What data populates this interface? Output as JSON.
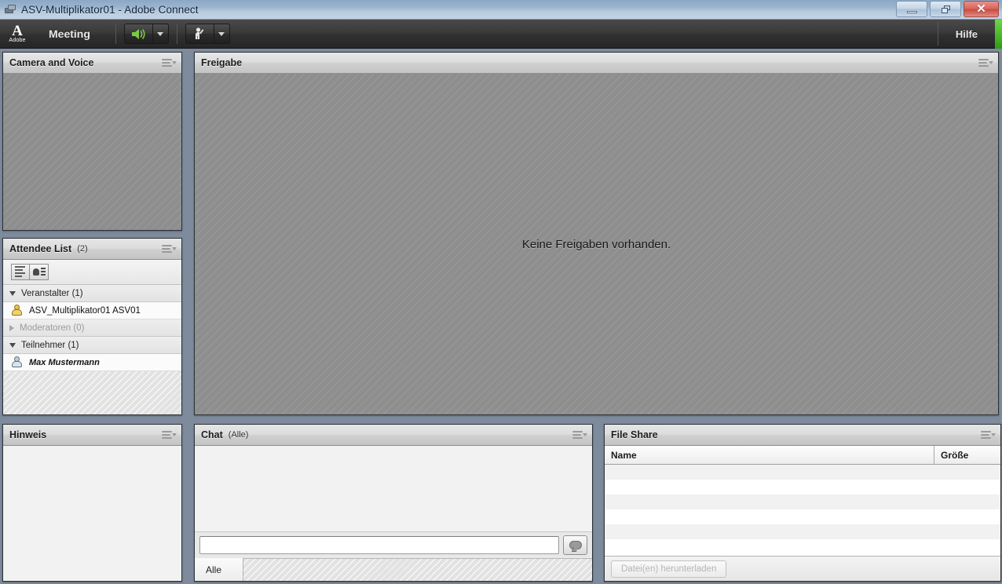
{
  "window": {
    "title": "ASV-Multiplikator01 - Adobe Connect",
    "icon": "app-icon",
    "minimize_label": "Minimieren",
    "restore_label": "Wiederherstellen",
    "close_label": "Schließen"
  },
  "toolbar": {
    "brand": "A",
    "brand_word": "Adobe",
    "meeting_label": "Meeting",
    "speaker_icon": "speaker-on-icon",
    "hand_icon": "raise-hand-icon",
    "help_label": "Hilfe",
    "accent_color": "#4fc229",
    "speaker_color": "#7ac943"
  },
  "camera_pod": {
    "title": "Camera and Voice",
    "menu_icon": "pod-options-icon"
  },
  "attendee_pod": {
    "title": "Attendee List",
    "count_label": "(2)",
    "menu_icon": "pod-options-icon",
    "view_buttons": [
      {
        "name": "list-view-button",
        "icon": "list-view-icon"
      },
      {
        "name": "card-view-button",
        "icon": "card-view-icon"
      }
    ],
    "groups": [
      {
        "label": "Veranstalter (1)",
        "expanded": true,
        "members": [
          {
            "name": "ASV_Multiplikator01 ASV01",
            "role": "host",
            "icon": "host-user-icon",
            "italic": false
          }
        ]
      },
      {
        "label": "Moderatoren (0)",
        "expanded": false,
        "dimmed": true,
        "members": []
      },
      {
        "label": "Teilnehmer (1)",
        "expanded": true,
        "members": [
          {
            "name": "Max Mustermann",
            "role": "participant",
            "icon": "participant-user-icon",
            "italic": true
          }
        ]
      }
    ]
  },
  "share_pod": {
    "title": "Freigabe",
    "menu_icon": "pod-options-icon",
    "empty_message": "Keine Freigaben vorhanden."
  },
  "note_pod": {
    "title": "Hinweis",
    "menu_icon": "pod-options-icon",
    "content": ""
  },
  "chat_pod": {
    "title": "Chat",
    "scope_label": "(Alle)",
    "menu_icon": "pod-options-icon",
    "input_value": "",
    "input_placeholder": "",
    "send_icon": "chat-bubble-icon",
    "tabs": [
      {
        "label": "Alle",
        "active": true
      }
    ]
  },
  "fileshare_pod": {
    "title": "File Share",
    "menu_icon": "pod-options-icon",
    "columns": [
      "Name",
      "Größe"
    ],
    "rows": [],
    "download_button": "Datei(en) herunterladen",
    "download_enabled": false
  }
}
